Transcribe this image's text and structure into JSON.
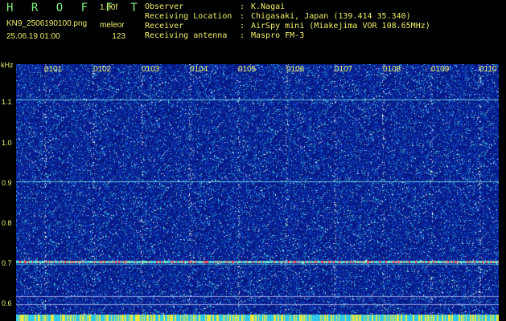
{
  "app": {
    "name": "H R O F F T",
    "version": "1.00f"
  },
  "file": {
    "name": "KN9_2506190100.png",
    "station": "meleor",
    "datetime": "25.06.19 01:00",
    "count": "123"
  },
  "info": [
    {
      "key": "Observer",
      "sep": ":",
      "value": "K.Nagai"
    },
    {
      "key": "Receiving Location",
      "sep": ":",
      "value": "Chigasaki, Japan (139.414 35.340)"
    },
    {
      "key": "Receiver",
      "sep": ":",
      "value": "AirSpy mini (Miakejima VOR 108.65MHz)"
    },
    {
      "key": "Receiving antenna",
      "sep": ":",
      "value": "Maspro FM-3"
    }
  ],
  "axis": {
    "y_unit": "kHz",
    "y_ticks": [
      "1.1",
      "1.0",
      "0.9",
      "0.8",
      "0.7",
      "0.6"
    ],
    "x_labels": [
      "0101",
      "0102",
      "0103",
      "0104",
      "0105",
      "0106",
      "0107",
      "0108",
      "0109",
      "0110"
    ]
  },
  "colors": {
    "text": "#f0f06a",
    "logo": "#7cf07c",
    "background": "#000000",
    "waterfall_base": "#0a1a8a"
  }
}
